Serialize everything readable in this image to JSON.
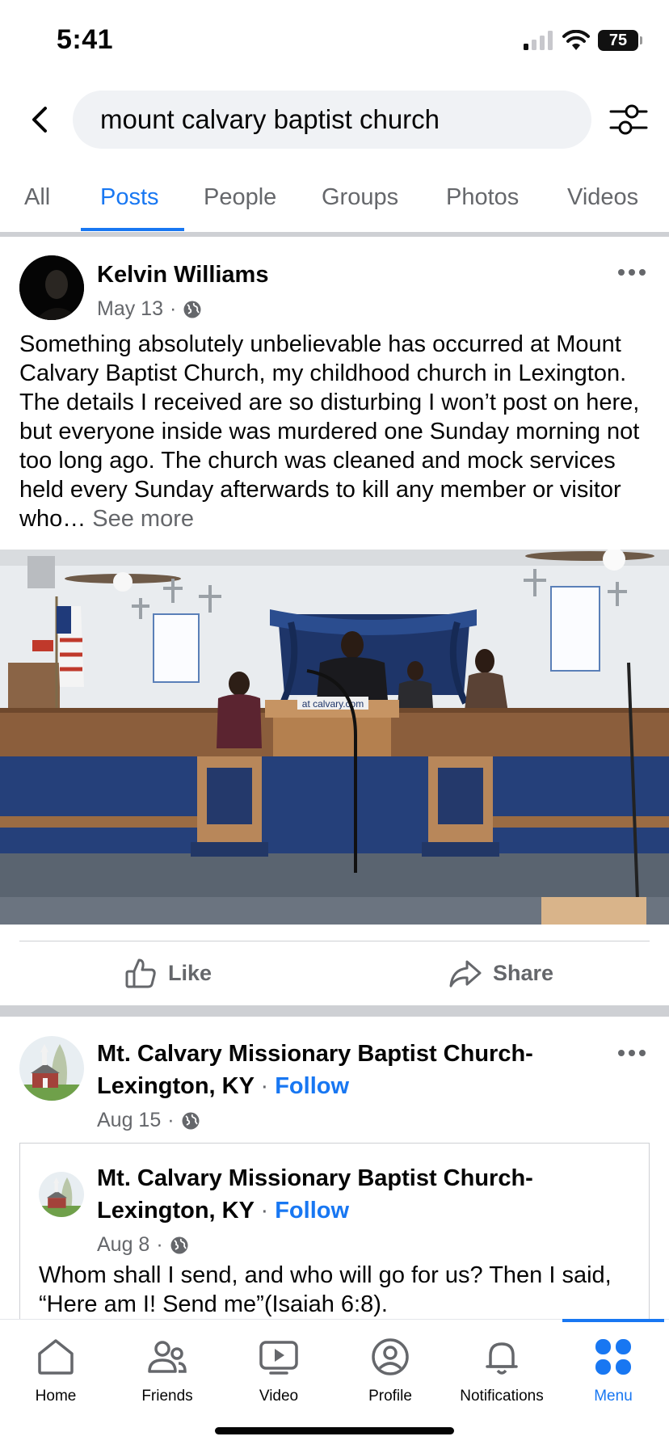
{
  "status_bar": {
    "time": "5:41",
    "battery": "75"
  },
  "search": {
    "query": "mount calvary baptist church"
  },
  "tabs": [
    {
      "label": "All",
      "active": false
    },
    {
      "label": "Posts",
      "active": true
    },
    {
      "label": "People",
      "active": false
    },
    {
      "label": "Groups",
      "active": false
    },
    {
      "label": "Photos",
      "active": false
    },
    {
      "label": "Videos",
      "active": false
    }
  ],
  "post1": {
    "author": "Kelvin Williams",
    "date": "May 13",
    "text": "Something absolutely unbelievable has occurred at Mount Calvary Baptist Church, my childhood church in Lexington. The details I received are so disturbing I won’t post on here, but everyone inside was murdered one Sunday morning not too long ago. The church was cleaned and mock services held every Sunday afterwards to kill any member or visitor who…",
    "see_more": "See more",
    "photo_sign_text": "at calvary.com",
    "like_label": "Like",
    "share_label": "Share"
  },
  "post2": {
    "author_line1": "Mt. Calvary Missionary Baptist Church-",
    "author_line2": "Lexington, KY",
    "follow": "Follow",
    "date": "Aug 15",
    "shared": {
      "author_line1": "Mt. Calvary Missionary Baptist Church-",
      "author_line2": "Lexington, KY",
      "follow": "Follow",
      "date": "Aug 8",
      "text": "Whom shall I send, and who will go for us? Then I said, “Here am I! Send me”(Isaiah 6:8)."
    }
  },
  "bottom_nav": [
    {
      "label": "Home",
      "icon": "home-icon"
    },
    {
      "label": "Friends",
      "icon": "friends-icon"
    },
    {
      "label": "Video",
      "icon": "video-icon"
    },
    {
      "label": "Profile",
      "icon": "profile-icon"
    },
    {
      "label": "Notifications",
      "icon": "bell-icon"
    },
    {
      "label": "Menu",
      "icon": "menu-icon",
      "active": true
    }
  ],
  "colors": {
    "accent": "#1877f2",
    "secondary_text": "#65676b",
    "divider": "#ced0d4"
  }
}
